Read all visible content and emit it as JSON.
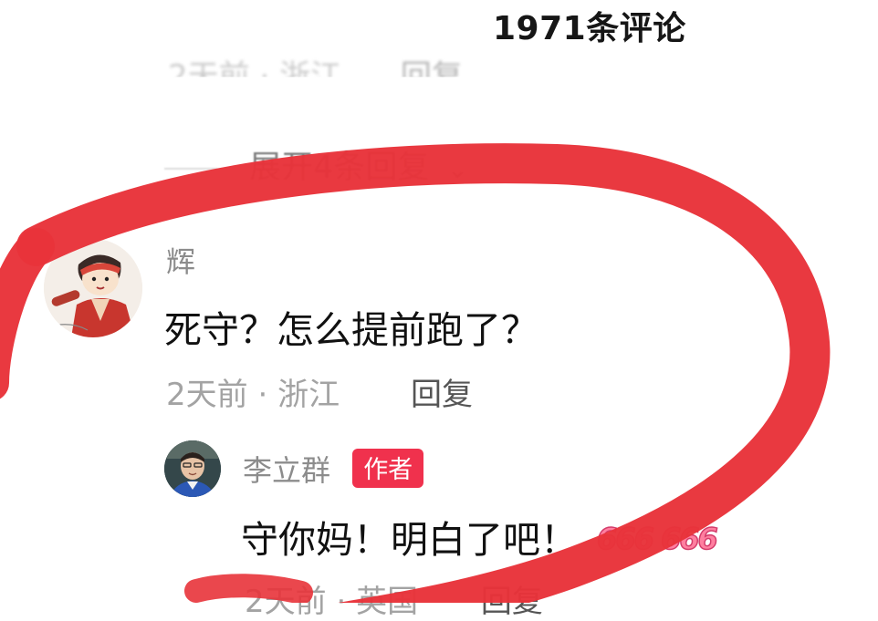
{
  "header": {
    "title": "1971条评论"
  },
  "previous_comment": {
    "time": "2天前",
    "location": "浙江",
    "reply_label": "回复"
  },
  "expand": {
    "label": "展开4条回复",
    "chevron": "⌄"
  },
  "comment": {
    "username": "辉",
    "text": "死守？怎么提前跑了？",
    "time": "2天前",
    "location": "浙江",
    "reply_label": "回复"
  },
  "reply": {
    "username": "李立群",
    "badge": "作者",
    "text": "守你妈！明白了吧！",
    "emoji_text": "666 666",
    "time": "2天前",
    "location": "英国",
    "reply_label": "回复"
  },
  "colors": {
    "marker_red": "#e8333a",
    "badge_red": "#f0314d"
  }
}
